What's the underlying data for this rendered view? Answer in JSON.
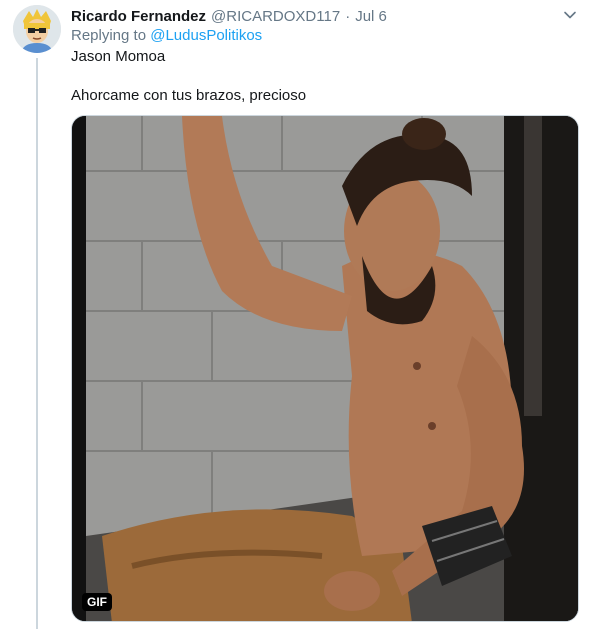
{
  "tweet": {
    "author_name": "Ricardo Fernandez",
    "author_handle": "@RICARDOXD117",
    "separator": "·",
    "date": "Jul 6",
    "replying_prefix": "Replying to",
    "replying_to": "@LudusPolitikos",
    "text_line1": "Jason Momoa",
    "text_line2": "Ahorcame con tus brazos, precioso",
    "media_badge": "GIF"
  },
  "colors": {
    "accent": "#1da1f2",
    "secondary_text": "#657786",
    "thread_line": "#ccd6dd"
  },
  "icons": {
    "menu": "chevron-down-icon",
    "avatar": "cartoon-avatar"
  }
}
